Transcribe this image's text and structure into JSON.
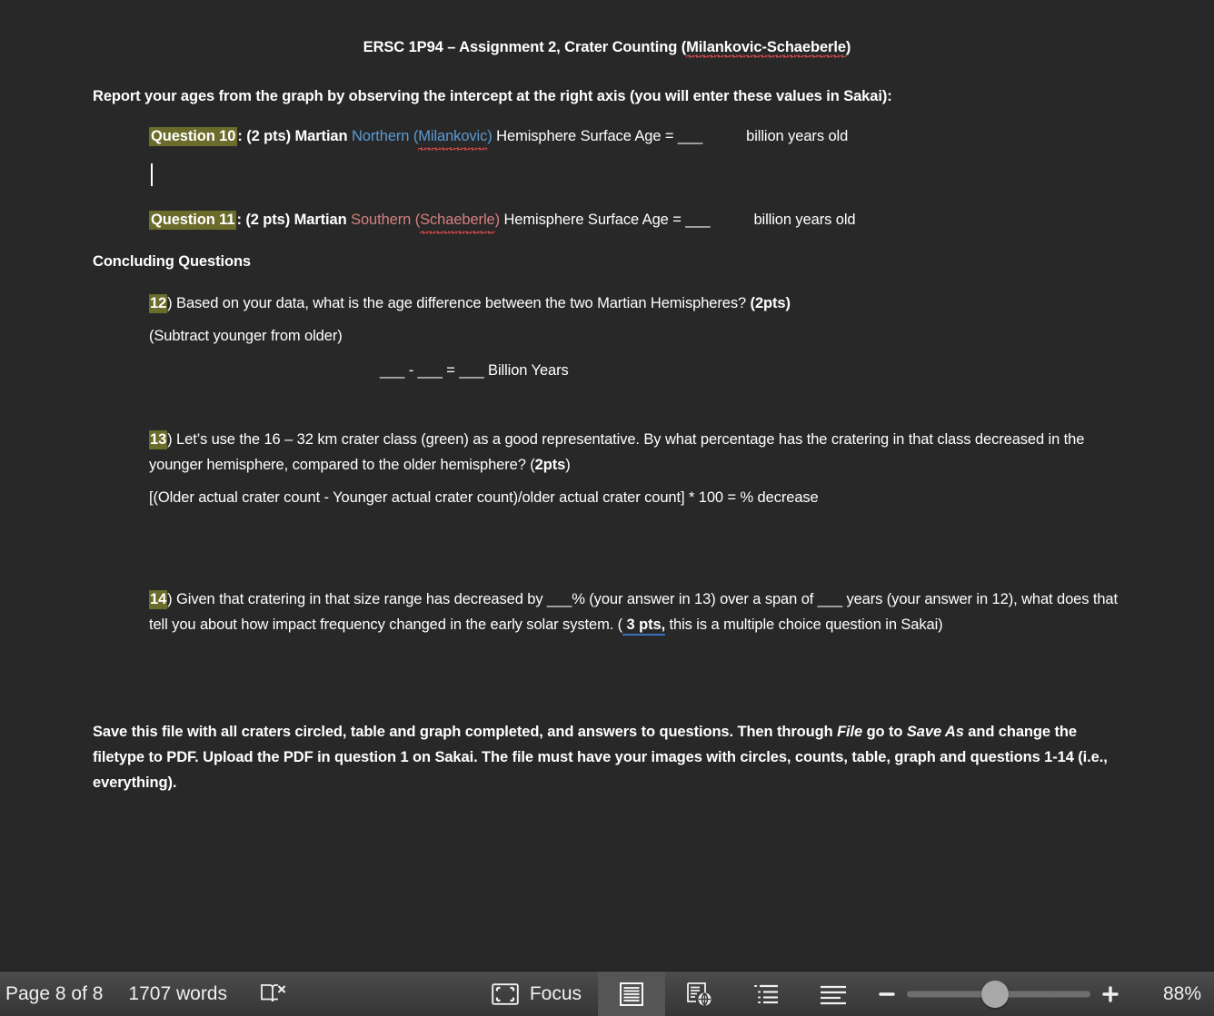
{
  "document": {
    "title": {
      "prefix": "ERSC 1P94 – Assignment 2, Crater Counting (",
      "misspelled": "Milankovic-Schaeberle",
      "suffix": ")"
    },
    "intro_heading": "Report your ages from the graph by observing the intercept at the right axis (you will enter these values in Sakai):",
    "question10": {
      "label": "Question 10",
      "after_label": ": (2 pts) Martian ",
      "hemisphere_word": "Northern (",
      "hemisphere_name": "Milankovic",
      "hemisphere_close": ")",
      "tail": " Hemisphere Surface Age =    ___",
      "units": "billion years old"
    },
    "question11": {
      "label": "Question 11",
      "after_label": ": (2 pts) Martian ",
      "hemisphere_word": "Southern (",
      "hemisphere_name": "Schaeberle",
      "hemisphere_close": ")",
      "tail": " Hemisphere Surface Age =    ___",
      "units": "billion years old"
    },
    "concluding_heading": "Concluding Questions",
    "question12": {
      "number": "12",
      "text": ")  Based on your data, what is the age difference between the two Martian Hemispheres?  ",
      "points": "(2pts)",
      "subnote": "(Subtract younger from older)",
      "formula": "___  -  ___  =  ___ Billion Years"
    },
    "question13": {
      "number": "13",
      "text_part1": ") Let’s use the 16 – 32 km crater class (green) as a good representative. By what percentage has the cratering in that class decreased in the younger hemisphere, compared to the older hemisphere? (",
      "points": "2pts",
      "text_part2": ")",
      "formula": "[(Older actual crater count - Younger actual crater count)/older actual crater count] * 100 =        % decrease"
    },
    "question14": {
      "number": "14",
      "text_part1": ") Given that cratering in that size range has decreased by ___% (your answer in 13) over a span of ___ years (your answer in 12), what does that tell you about how impact frequency changed in the early solar system. (",
      "points_underlined": " 3 pts,",
      "text_part2": " this is a multiple choice question in Sakai)"
    },
    "closing": {
      "part1": "Save this file with all craters circled, table and graph completed, and answers to questions. Then through ",
      "italic1": "File",
      "part2": " go to ",
      "italic2": "Save As",
      "part3": " and change the filetype to PDF. Upload the PDF in question 1 on Sakai. The file must have your images with circles, counts, table, graph and questions 1-14 (i.e., everything)."
    }
  },
  "statusbar": {
    "page_count": "Page 8 of 8",
    "word_count": "1707 words",
    "spellcheck_icon": "book-x-icon",
    "focus_label": "Focus",
    "focus_icon": "fullscreen-corners-icon",
    "view_modes": [
      {
        "name": "print-layout",
        "icon": "page-lines-icon",
        "active": true
      },
      {
        "name": "web-layout",
        "icon": "page-globe-icon",
        "active": false
      },
      {
        "name": "outline",
        "icon": "bullet-list-icon",
        "active": false
      },
      {
        "name": "draft",
        "icon": "lines-icon",
        "active": false
      }
    ],
    "zoom_out_label": "−",
    "zoom_in_label": "+",
    "zoom_level": "88%",
    "zoom_thumb_percent": 48
  },
  "colors": {
    "page_background": "#282828",
    "text": "#ffffff",
    "highlight": "#6b6b2b",
    "northern_blue": "#5b9bd5",
    "southern_red": "#d4807f",
    "spell_underline": "#d94a4a",
    "tracked_change_underline": "#3a6fbf",
    "statusbar_top": "#4d4d4d",
    "statusbar_bottom": "#363636",
    "active_view_button": "#555555"
  }
}
